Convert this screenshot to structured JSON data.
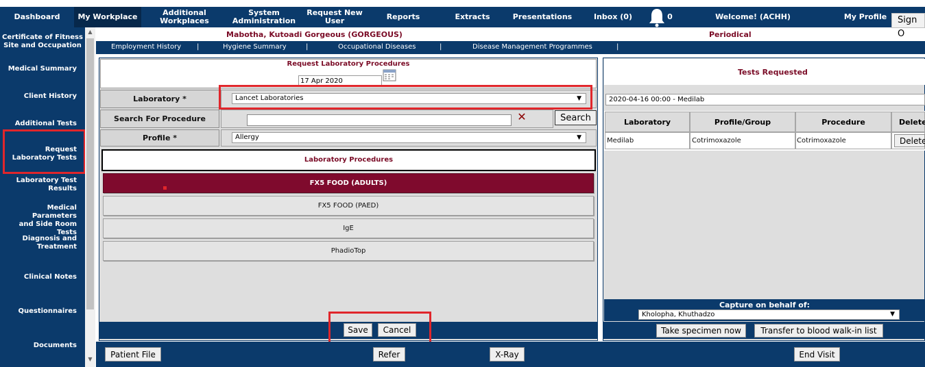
{
  "nav": {
    "items": [
      "Dashboard",
      "My Workplace",
      "Additional Workplaces",
      "System Administration",
      "Request New User",
      "Reports",
      "Extracts",
      "Presentations",
      "Inbox (0)"
    ],
    "additional_l1": "Additional",
    "additional_l2": "Workplaces",
    "sysadmin_l1": "System",
    "sysadmin_l2": "Administration",
    "requser_l1": "Request New",
    "requser_l2": "User",
    "bell_count": "0",
    "welcome": "Welcome! (ACHH)",
    "profile": "My Profile",
    "sign_out": "Sign O"
  },
  "sidebar": {
    "certificate_l1": "Certificate of Fitness",
    "certificate_l2": "Site and Occupation",
    "medical_summary": "Medical Summary",
    "client_history": "Client History",
    "additional_tests": "Additional Tests",
    "request_l1": "Request",
    "request_l2": "Laboratory Tests",
    "results_l1": "Laboratory Test",
    "results_l2": "Results",
    "params_l1": "Medical Parameters",
    "params_l2": "and Side Room Tests",
    "diag_l1": "Diagnosis and",
    "diag_l2": "Treatment",
    "clinical_notes": "Clinical Notes",
    "questionnaires": "Questionnaires",
    "documents": "Documents"
  },
  "patient": {
    "name": "Mabotha, Kutoadi Gorgeous (GORGEOUS)",
    "visit_type": "Periodical"
  },
  "subnav": [
    "Employment History",
    "Hygiene Summary",
    "Occupational Diseases",
    "Disease Management Programmes"
  ],
  "request": {
    "title": "Request Laboratory Procedures",
    "date": "17 Apr 2020",
    "laboratory_label": "Laboratory *",
    "laboratory_value": "Lancet Laboratories",
    "search_label": "Search For Procedure",
    "search_value": "",
    "search_button": "Search",
    "profile_label": "Profile *",
    "profile_value": "Allergy",
    "procedures_header": "Laboratory Procedures",
    "procedures": [
      "FX5 FOOD (ADULTS)",
      "FX5 FOOD (PAED)",
      "IgE",
      "PhadioTop"
    ],
    "save": "Save",
    "cancel": "Cancel"
  },
  "tests": {
    "title": "Tests Requested",
    "selected": "2020-04-16 00:00 - Medilab",
    "columns": [
      "Laboratory",
      "Profile/Group",
      "Procedure",
      "Delete"
    ],
    "rows": [
      {
        "laboratory": "Medilab",
        "profile": "Cotrimoxazole",
        "procedure": "Cotrimoxazole",
        "delete": "Delete"
      }
    ],
    "capture_label": "Capture on behalf of:",
    "capture_value": "Kholopha, Khuthadzo",
    "take_specimen": "Take specimen now",
    "transfer": "Transfer to blood walk-in list"
  },
  "footer": {
    "patient_file": "Patient File",
    "refer": "Refer",
    "xray": "X-Ray",
    "end_visit": "End Visit"
  },
  "colors": {
    "navy": "#0b3a6b",
    "maroon": "#7a0b26",
    "highlight": "#e0262b"
  }
}
